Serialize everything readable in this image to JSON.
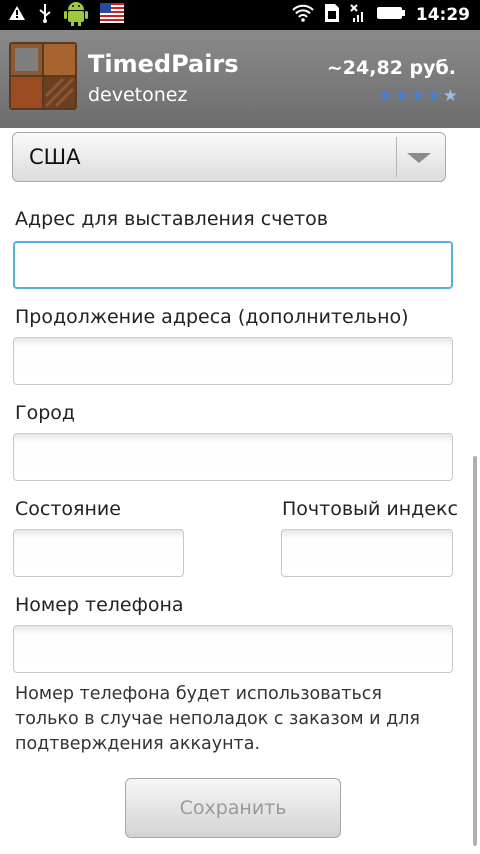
{
  "status_bar": {
    "time": "14:29",
    "icons_left": [
      "warning-icon",
      "usb-icon",
      "android-debug-icon",
      "us-flag-icon"
    ],
    "icons_right": [
      "wifi-icon",
      "sim-icon",
      "no-signal-icon",
      "battery-icon"
    ]
  },
  "app": {
    "name": "TimedPairs",
    "developer": "devetonez",
    "price": "~24,82 руб.",
    "rating": 4.5
  },
  "form": {
    "country_value": "США",
    "billing_address_label": "Адрес для выставления счетов",
    "billing_address_value": "",
    "address_cont_label": "Продолжение адреса (дополнительно)",
    "address_cont_value": "",
    "city_label": "Город",
    "city_value": "",
    "state_label": "Состояние",
    "state_value": "",
    "zip_label": "Почтовый индекс",
    "zip_value": "",
    "phone_label": "Номер телефона",
    "phone_value": "",
    "phone_help": "Номер телефона будет использоваться только в случае неполадок с заказом и для подтверждения аккаунта.",
    "save_label": "Сохранить"
  },
  "colors": {
    "focus_border": "#54b1d8",
    "star": "#4a7fd4"
  }
}
